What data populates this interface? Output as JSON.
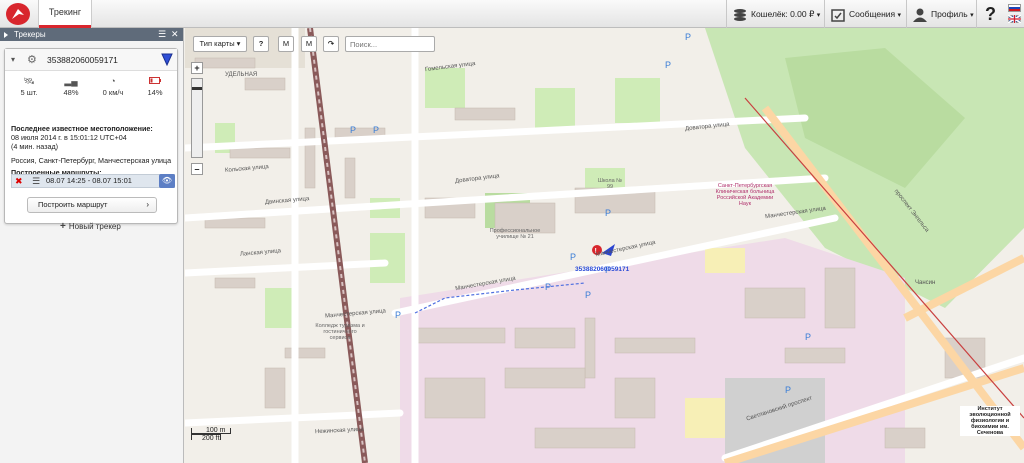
{
  "header": {
    "tab_label": "Трекинг",
    "wallet_label": "Кошелёк: 0.00 ₽",
    "messages_label": "Сообщения",
    "profile_label": "Профиль",
    "help_label": "?"
  },
  "sidebar": {
    "title": "Трекеры",
    "tracker": {
      "id": "353882060059171",
      "stats": [
        {
          "icon": "satellite-icon",
          "value": "5 шт."
        },
        {
          "icon": "signal-icon",
          "value": "48%"
        },
        {
          "icon": "speedometer-icon",
          "value": "0 км/ч"
        },
        {
          "icon": "battery-icon",
          "value": "14%"
        }
      ],
      "last_location_label": "Последнее известное местоположение:",
      "last_location_time": "08 июля 2014 г. в 15:01:12 UTC+04",
      "last_location_ago": "(4 мин. назад)",
      "address": "Россия, Санкт-Петербург, Манчестерская улица",
      "routes_label": "Построенные маршруты:",
      "route_range": "08.07 14:25 - 08.07 15:01",
      "build_route_label": "Построить маршрут"
    },
    "new_tracker_label": "Новый трекер"
  },
  "map": {
    "map_type_label": "Тип карты",
    "search_placeholder": "Поиск...",
    "tool_help": "?",
    "tool_measure": "M",
    "tool_measure2": "M",
    "marker_label": "353882060059171",
    "scale_m": "100 m",
    "scale_ft": "200 ft",
    "labels": {
      "udelnaya": "УДЕЛЬНАЯ",
      "manchesterskaya1": "Манчестерская улица",
      "manchesterskaya2": "Манчестерская улица",
      "manchesterskaya3": "Манчестерская улица",
      "manchesterskaya4": "Манчестерская улица",
      "dovatora1": "Доватора улица",
      "dovatora2": "Доватора улица",
      "kolskaya": "Кольская улица",
      "lanskaya": "Ланская улица",
      "nezhinskaya": "Нежинская улица",
      "dvinskaya": "Двинская улица",
      "gomelskaya": "Гомельская улица",
      "svetlanovsky": "Светлановский проспект",
      "engelsa": "проспект Энгельса",
      "chansin": "Чансин",
      "profuch": "Профессиональное училище № 21",
      "shkola": "Школа № 99",
      "hospital": "Санкт-Петербургская Клиническая больница Российской Академии Наук",
      "college": "Колледж туризма и гостиничного сервиса",
      "institute": "Институт эволюционной физиологии и биохимии им. Сеченова"
    }
  }
}
